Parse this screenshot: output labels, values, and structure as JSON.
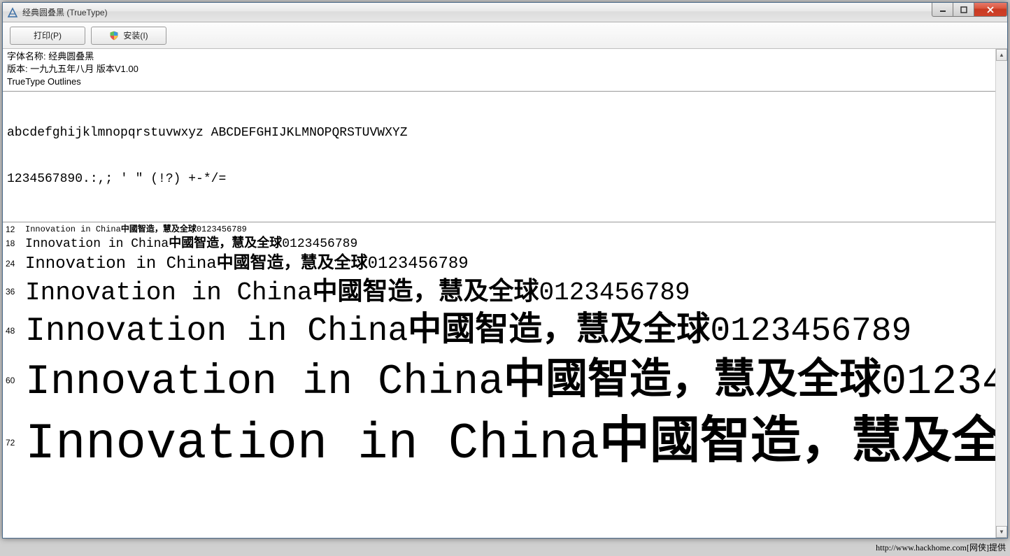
{
  "window": {
    "title": "经典圆叠黑 (TrueType)"
  },
  "toolbar": {
    "print_label": "打印(P)",
    "install_label": "安装(I)"
  },
  "info": {
    "font_name_line": "字体名称: 经典圆叠黑",
    "version_line": "版本: 一九九五年八月 版本V1.00",
    "outlines_line": "TrueType Outlines"
  },
  "charset": {
    "line1": "abcdefghijklmnopqrstuvwxyz ABCDEFGHIJKLMNOPQRSTUVWXYZ",
    "line2": "1234567890.:,; ' \" (!?) +-*/="
  },
  "sample_latin": "Innovation in China ",
  "sample_cjk": "中國智造，慧及全球 ",
  "sample_numbers": "0123456789",
  "sample_sizes": [
    12,
    18,
    24,
    36,
    48,
    60,
    72
  ],
  "footer": "http://www.hackhome.com[网侠]提供"
}
